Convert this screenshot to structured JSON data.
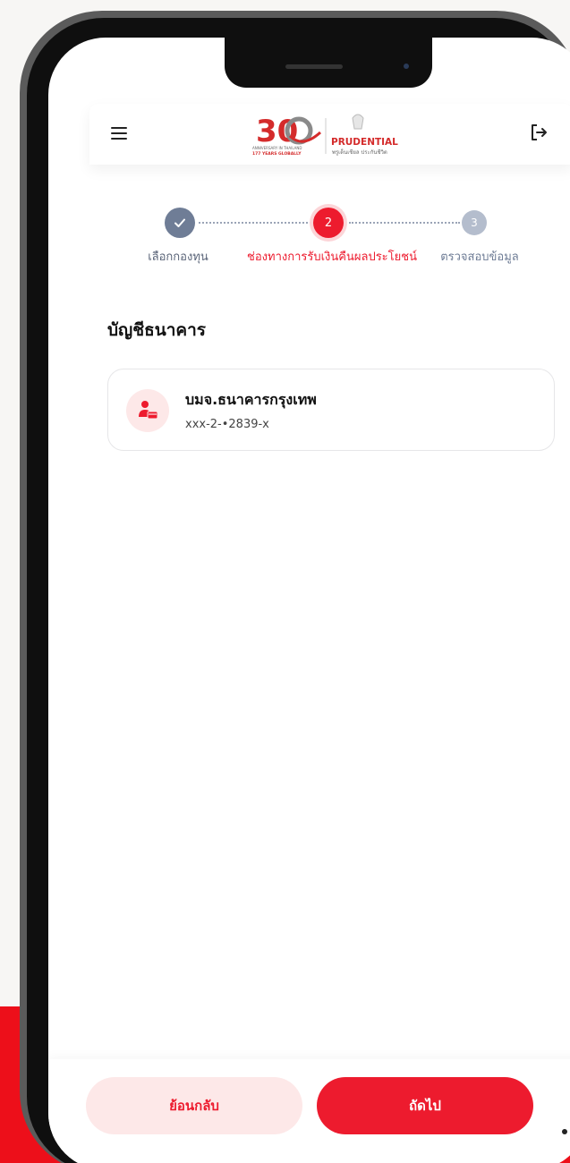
{
  "header": {
    "menu_icon": "hamburger-menu-icon",
    "logo": {
      "anniversary_number": "30",
      "anniversary_line1": "ANNIVERSARY IN THAILAND",
      "anniversary_line2": "177 YEARS GLOBALLY",
      "brand_name": "PRUDENTIAL",
      "brand_tagline": "พรูเด็นเชียล ประกันชีวิต"
    },
    "logout_icon": "logout-icon"
  },
  "stepper": {
    "steps": [
      {
        "number": "",
        "label": "เลือกกองทุน",
        "state": "completed"
      },
      {
        "number": "2",
        "label": "ช่องทางการรับเงินคืนผลประโยชน์",
        "state": "active"
      },
      {
        "number": "3",
        "label": "ตรวจสอบข้อมูล",
        "state": "upcoming"
      }
    ]
  },
  "section": {
    "title": "บัญชีธนาคาร"
  },
  "bank_account": {
    "icon": "bank-account-icon",
    "bank_name": "บมจ.ธนาคารกรุงเทพ",
    "account_number": "xxx-2-•2839-x"
  },
  "footer": {
    "back_label": "ย้อนกลับ",
    "next_label": "ถัดไป"
  },
  "colors": {
    "brand_red": "#ed1b2e",
    "completed_step": "#6f7d96",
    "upcoming_step": "#b4bdcd",
    "light_red_bg": "#fde8e8"
  }
}
